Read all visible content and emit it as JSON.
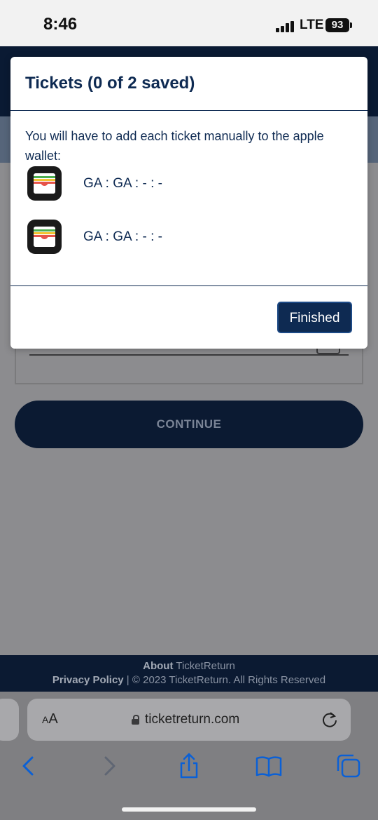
{
  "status_bar": {
    "time": "8:46",
    "carrier": "LTE",
    "battery": "93"
  },
  "modal": {
    "title": "Tickets (0 of 2 saved)",
    "message": "You will have to add each ticket manually to the apple wallet:",
    "tickets": [
      {
        "label": "GA : GA : - : -",
        "icon": "apple-wallet-icon"
      },
      {
        "label": "GA : GA : - : -",
        "icon": "apple-wallet-icon"
      }
    ],
    "finished_label": "Finished"
  },
  "page": {
    "continue_label": "CONTINUE",
    "footer": {
      "about_bold": "About",
      "about_rest": " TicketReturn",
      "privacy": "Privacy Policy",
      "separator": " | ",
      "copyright_symbol": "©",
      "copyright": " 2023 TicketReturn. All Rights Reserved"
    }
  },
  "browser": {
    "aa_label_small": "A",
    "aa_label_large": "A",
    "url": "ticketreturn.com",
    "toolbar": [
      "back-icon",
      "forward-icon",
      "share-icon",
      "bookmarks-icon",
      "tabs-icon"
    ]
  },
  "colors": {
    "navy": "#0e2a52",
    "dark_header": "#0a1a33",
    "ios_blue": "#0a60d6",
    "wallet_green": "#4caf50",
    "wallet_yellow": "#f2c230",
    "wallet_red": "#e6534a"
  }
}
